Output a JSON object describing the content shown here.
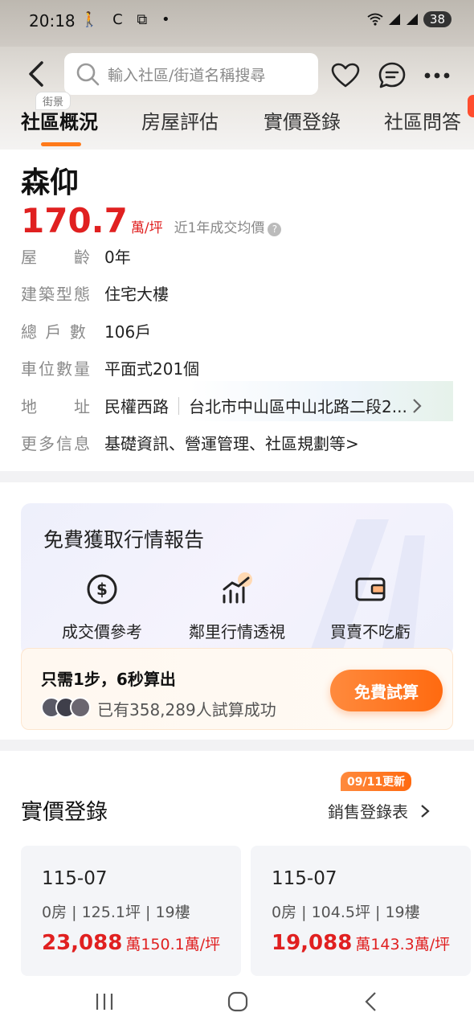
{
  "status_bar": {
    "time": "20:18",
    "left_icons": "🚶 C ⧉ •",
    "battery": "38"
  },
  "header": {
    "search_placeholder": "輸入社區/街道名稱搜尋",
    "street_view_label": "街景",
    "tabs": [
      "社區概況",
      "房屋評估",
      "實價登錄",
      "社區問答"
    ]
  },
  "community": {
    "name": "森仰",
    "avg_price": "170.7",
    "avg_price_unit": "萬/坪",
    "avg_price_desc": "近1年成交均價",
    "details": [
      {
        "label": "屋　　齡",
        "value": "0年"
      },
      {
        "label": "建築型態",
        "value": "住宅大樓"
      },
      {
        "label": "總 戶 數",
        "value": "106戶"
      },
      {
        "label": "車位數量",
        "value": "平面式201個"
      }
    ],
    "address": {
      "label": "地　　址",
      "road": "民權西路",
      "full": "台北市中山區中山北路二段2..."
    },
    "more_info": {
      "label": "更多信息",
      "value": "基礎資訊、營運管理、社區規劃等>"
    }
  },
  "report": {
    "title": "免費獲取行情報告",
    "features": [
      "成交價參考",
      "鄰里行情透視",
      "買賣不吃虧"
    ],
    "calc_title": "只需1步，6秒算出",
    "calc_count": "已有358,289人試算成功",
    "calc_button": "免費試算"
  },
  "deals": {
    "title": "實價登錄",
    "update_badge": "09/11更新",
    "link_label": "銷售登錄表",
    "items": [
      {
        "date": "115-07",
        "spec": "0房 | 125.1坪 | 19樓",
        "total": "23,088",
        "unit": "萬150.1萬/坪"
      },
      {
        "date": "115-07",
        "spec": "0房 | 104.5坪 | 19樓",
        "total": "19,088",
        "unit": "萬143.3萬/坪"
      }
    ]
  },
  "colors": {
    "accent": "#ff7a1a",
    "price_red": "#e02020"
  }
}
